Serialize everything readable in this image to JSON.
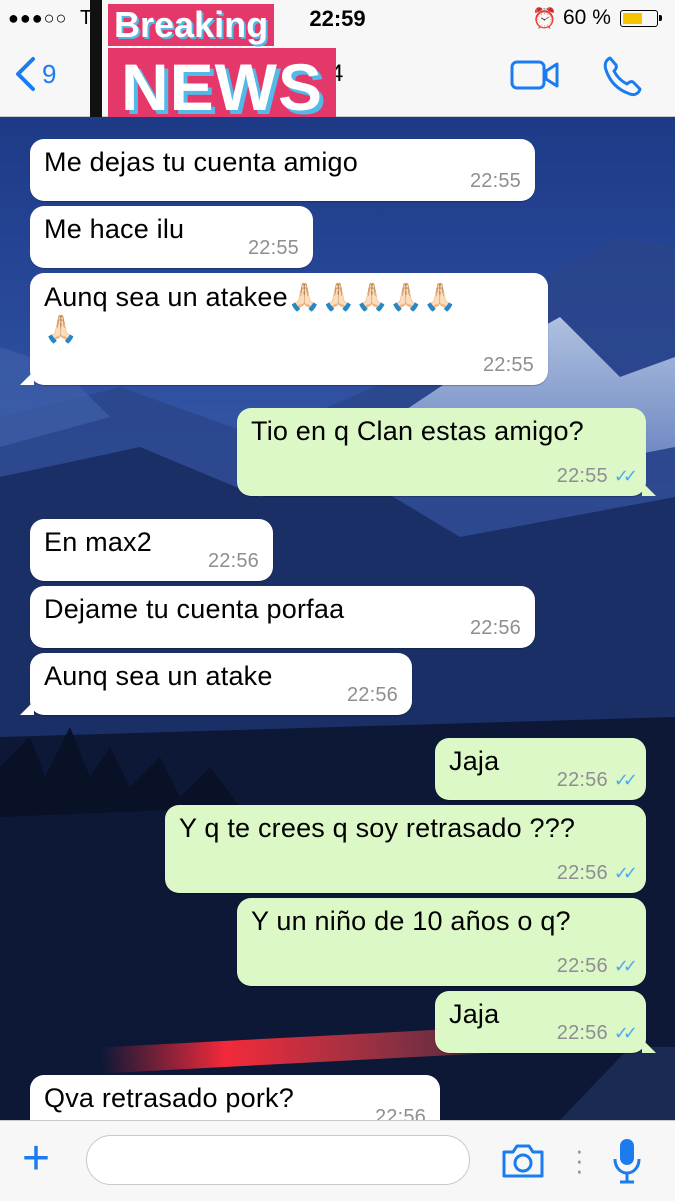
{
  "status_bar": {
    "signal": "●●●○○",
    "carrier": "T",
    "time": "22:59",
    "battery_percent": "60 %",
    "battery_level": 0.6,
    "icons": [
      "alarm-icon",
      "battery-icon"
    ]
  },
  "nav": {
    "back_count": "9",
    "contact_fragment": "4",
    "icons": [
      "chevron-left-icon",
      "video-call-icon",
      "phone-icon"
    ],
    "accent": "#1b7cf0"
  },
  "overlay": {
    "line1": "Breaking",
    "line2": "NEWS",
    "colors": {
      "fill": "#e5386a",
      "shadow": "#52b9e8"
    }
  },
  "messages": [
    {
      "dir": "in",
      "text": "Me dejas tu cuenta amigo",
      "time": "22:55"
    },
    {
      "dir": "in",
      "text": "Me hace ilu",
      "time": "22:55"
    },
    {
      "dir": "in",
      "text": "Aunq sea un atakee🙏🏻🙏🏻🙏🏻🙏🏻🙏🏻",
      "text2": "🙏🏻",
      "time": "22:55"
    },
    {
      "dir": "out",
      "text": "Tio en q Clan estas amigo?",
      "time": "22:55",
      "ticks": "✓✓"
    },
    {
      "dir": "in",
      "text": "En max2",
      "time": "22:56"
    },
    {
      "dir": "in",
      "text": "Dejame tu cuenta porfaa",
      "time": "22:56"
    },
    {
      "dir": "in",
      "text": "Aunq sea un atake",
      "time": "22:56"
    },
    {
      "dir": "out",
      "text": "Jaja",
      "time": "22:56",
      "ticks": "✓✓"
    },
    {
      "dir": "out",
      "text": "Y q te crees q soy retrasado ???",
      "time": "22:56",
      "ticks": "✓✓"
    },
    {
      "dir": "out",
      "text": "Y un niño de 10 años o q?",
      "time": "22:56",
      "ticks": "✓✓"
    },
    {
      "dir": "out",
      "text": "Jaja",
      "time": "22:56",
      "ticks": "✓✓"
    },
    {
      "dir": "in",
      "text": "Qva retrasado pork?",
      "time": "22:56"
    }
  ],
  "input_bar": {
    "placeholder": "",
    "icons": [
      "plus-icon",
      "camera-icon",
      "more-dots-icon",
      "microphone-icon"
    ]
  },
  "colors": {
    "incoming_bubble": "#ffffff",
    "outgoing_bubble": "#dcf8c6",
    "read_ticks": "#4fa8f0",
    "timestamp": "#8e8e93"
  }
}
